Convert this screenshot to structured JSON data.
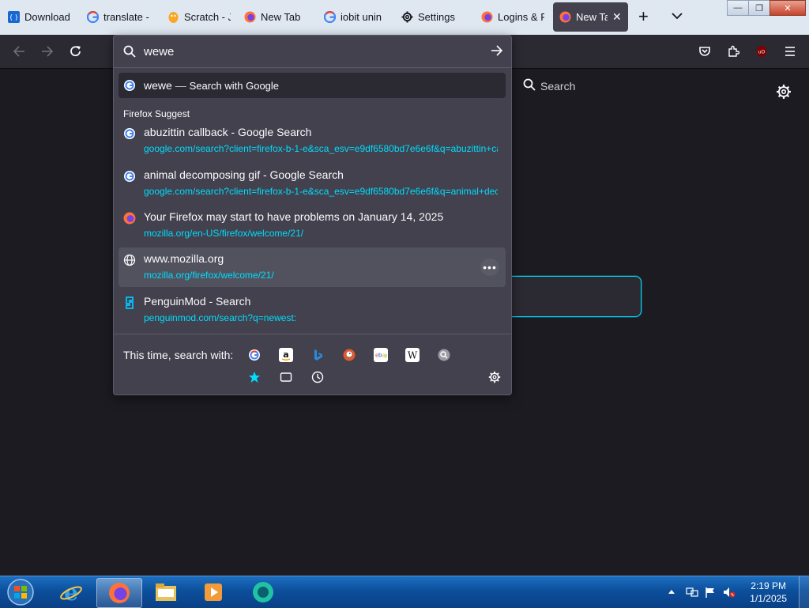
{
  "tabs": [
    {
      "label": "Download",
      "icon": "download-page-icon"
    },
    {
      "label": "translate -",
      "icon": "google-icon"
    },
    {
      "label": "Scratch - J",
      "icon": "scratch-icon"
    },
    {
      "label": "New Tab",
      "icon": "firefox-icon"
    },
    {
      "label": "iobit unin",
      "icon": "google-icon"
    },
    {
      "label": "Settings",
      "icon": "gear-icon"
    },
    {
      "label": "Logins & P",
      "icon": "firefox-icon"
    },
    {
      "label": "New Ta",
      "icon": "firefox-icon",
      "active": true
    }
  ],
  "window_controls": {
    "minimize": "—",
    "maximize": "❐",
    "close": "✕"
  },
  "urlbar": {
    "query": "wewe"
  },
  "search_bar": {
    "placeholder": "Search"
  },
  "dropdown": {
    "heuristic": {
      "query": "wewe",
      "separator": "—",
      "action": "Search with Google"
    },
    "section_label": "Firefox Suggest",
    "results": [
      {
        "title": "abuzittin callback - Google Search",
        "url": "google.com/search?client=firefox-b-1-e&sca_esv=e9df6580bd7e6e6f&q=abuzittin+callback",
        "icon": "google-icon"
      },
      {
        "title": "animal decomposing gif - Google Search",
        "url": "google.com/search?client=firefox-b-1-e&sca_esv=e9df6580bd7e6e6f&q=animal+decomposing+gif",
        "icon": "google-icon"
      },
      {
        "title": "Your Firefox may start to have problems on January 14, 2025",
        "url": "mozilla.org/en-US/firefox/welcome/21/",
        "icon": "firefox-icon"
      },
      {
        "title": "www.mozilla.org",
        "url": "mozilla.org/firefox/welcome/21/",
        "icon": "globe-icon",
        "selected": true
      },
      {
        "title": "PenguinMod - Search",
        "url": "penguinmod.com/search?q=newest:",
        "icon": "penguinmod-icon"
      }
    ],
    "one_off_label": "This time, search with:",
    "engines": [
      "google-icon",
      "amazon-icon",
      "bing-icon",
      "duckduckgo-icon",
      "ebay-icon",
      "wikipedia-icon",
      "search-engine-icon"
    ],
    "modes": [
      "bookmarks-star-icon",
      "tabs-icon",
      "history-icon"
    ]
  },
  "taskbar": {
    "apps": [
      "start-orb-icon",
      "internet-explorer-icon",
      "firefox-icon",
      "file-explorer-icon",
      "media-player-icon",
      "app-icon"
    ],
    "time": "2:19 PM",
    "date": "1/1/2025"
  },
  "colors": {
    "accent": "#00ddff",
    "popup": "#42414d",
    "toolbar": "#2b2a33",
    "page": "#1c1b22"
  }
}
